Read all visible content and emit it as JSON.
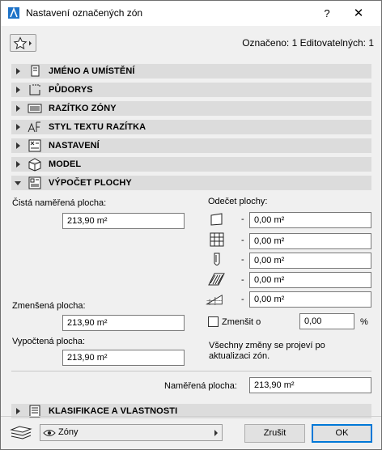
{
  "window": {
    "title": "Nastavení označených zón",
    "help_label": "?",
    "close_label": "✕",
    "selected_info": "Označeno: 1 Editovatelných: 1"
  },
  "panels": [
    {
      "label": "JMÉNO A UMÍSTĚNÍ",
      "icon": "name-location-icon",
      "expanded": false
    },
    {
      "label": "PŮDORYS",
      "icon": "floor-plan-icon",
      "expanded": false
    },
    {
      "label": "RAZÍTKO ZÓNY",
      "icon": "zone-stamp-icon",
      "expanded": false
    },
    {
      "label": "STYL TEXTU RAZÍTKA",
      "icon": "text-style-icon",
      "expanded": false
    },
    {
      "label": "NASTAVENÍ",
      "icon": "settings-icon",
      "expanded": false
    },
    {
      "label": "MODEL",
      "icon": "model-icon",
      "expanded": false
    },
    {
      "label": "VÝPOČET PLOCHY",
      "icon": "area-calculation-icon",
      "expanded": true
    }
  ],
  "area": {
    "net_label": "Čistá naměřená plocha:",
    "net_value": "213,90 m²",
    "reduced_label": "Zmenšená plocha:",
    "reduced_value": "213,90 m²",
    "calculated_label": "Vypočtená plocha:",
    "calculated_value": "213,90 m²",
    "deduction_label": "Odečet plochy:",
    "deductions": [
      {
        "icon": "wall-icon",
        "dash": "-",
        "value": "0,00 m²"
      },
      {
        "icon": "grid-icon",
        "dash": "-",
        "value": "0,00 m²"
      },
      {
        "icon": "column-icon",
        "dash": "-",
        "value": "0,00 m²"
      },
      {
        "icon": "hatch-fill-icon",
        "dash": "-",
        "value": "0,00 m²"
      },
      {
        "icon": "low-height-icon",
        "dash": "-",
        "value": "0,00 m²"
      }
    ],
    "reduce_label": "Zmenšit o",
    "reduce_value": "0,00",
    "reduce_unit": "%",
    "note_line1": "Všechny změny se projeví po",
    "note_line2": "aktualizaci zón.",
    "measured_label": "Naměřená plocha:",
    "measured_value": "213,90 m²"
  },
  "classification_panel": {
    "label": "KLASIFIKACE A VLASTNOSTI",
    "icon": "classification-icon"
  },
  "footer": {
    "layer_value": "Zóny",
    "cancel_label": "Zrušit",
    "ok_label": "OK"
  },
  "colors": {
    "ok_border": "#0078d7",
    "panel_header": "#dcdcdc",
    "dialog_bg": "#f0f0f0"
  }
}
